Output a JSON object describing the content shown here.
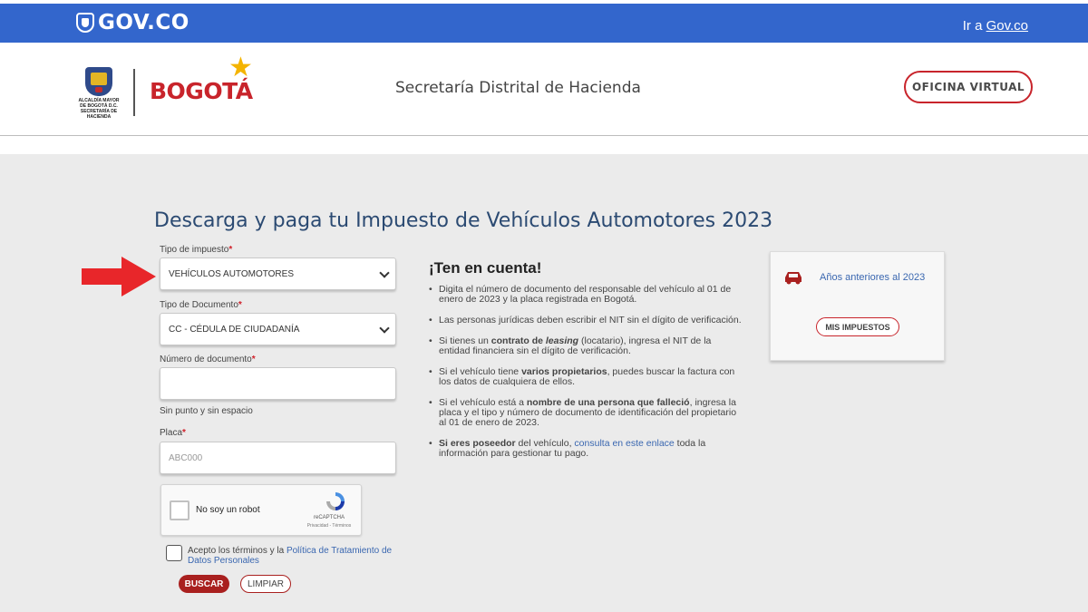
{
  "govbar": {
    "logo_text": "GOV.CO",
    "link_prefix": "Ir a",
    "link_text": "Gov.co"
  },
  "header": {
    "alcaldia_text": "ALCALDÍA MAYOR\nDE BOGOTÁ D.C.\nSECRETARÍA DE HACIENDA",
    "bogota_text": "BOGOTÁ",
    "secretaria": "Secretaría Distrital de Hacienda",
    "oficina_button": "OFICINA VIRTUAL"
  },
  "form": {
    "title": "Descarga y paga tu Impuesto de Vehículos Automotores 2023",
    "tipo_impuesto_label": "Tipo de impuesto",
    "tipo_impuesto_value": "VEHÍCULOS AUTOMOTORES",
    "tipo_documento_label": "Tipo de Documento",
    "tipo_documento_value": "CC - CÉDULA DE CIUDADANÍA",
    "numero_label": "Número de documento",
    "numero_value": "",
    "numero_hint": "Sin punto y sin espacio",
    "placa_label": "Placa",
    "placa_placeholder": "ABC000",
    "required_mark": "*",
    "captcha_text": "No soy un robot",
    "captcha_brand": "reCAPTCHA",
    "captcha_links": "Privacidad - Términos",
    "terms_prefix": "Acepto los términos y la ",
    "terms_link": "Política de Tratamiento de Datos Personales",
    "buscar_button": "BUSCAR",
    "limpiar_button": "LIMPIAR"
  },
  "info": {
    "title": "¡Ten en cuenta!",
    "item1": "Digita el número de documento del responsable del vehículo al 01 de enero de 2023 y la placa registrada en Bogotá.",
    "item2": "Las personas jurídicas deben escribir el NIT sin el dígito de verificación.",
    "item3_a": "Si tienes un ",
    "item3_b": "contrato de ",
    "item3_c": "leasing",
    "item3_d": " (locatario), ingresa el NIT de la entidad financiera sin el dígito de verificación.",
    "item4_a": "Si el vehículo tiene ",
    "item4_b": "varios propietarios",
    "item4_c": ", puedes buscar la factura con los datos de cualquiera de ellos.",
    "item5_a": "Si el vehículo está a ",
    "item5_b": "nombre de una persona que falleció",
    "item5_c": ", ingresa la placa y el tipo y número de documento de identificación del propietario al 01 de enero de 2023.",
    "item6_a": "Si eres poseedor",
    "item6_b": " del vehículo, ",
    "item6_link": "consulta en este enlace",
    "item6_c": " toda la información para gestionar tu pago."
  },
  "side_card": {
    "link_text": "Años anteriores al 2023",
    "button": "MIS IMPUESTOS"
  },
  "colors": {
    "gov_blue": "#3366cc",
    "brand_red": "#c8242b",
    "title_blue": "#2b4a72",
    "arrow_red": "#e8262a"
  }
}
